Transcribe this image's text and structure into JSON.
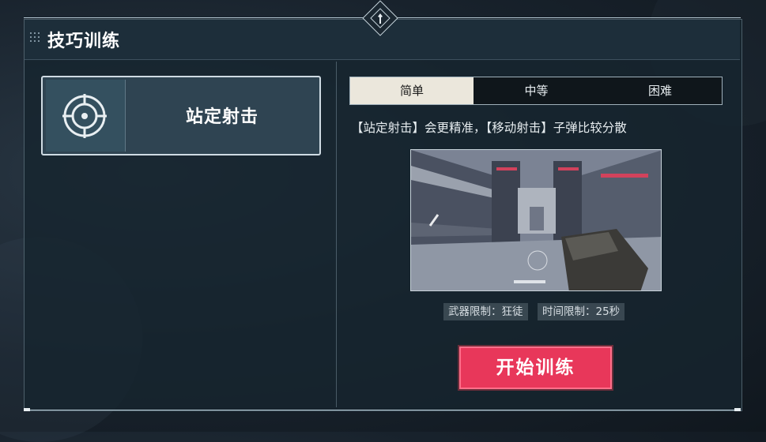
{
  "header": {
    "title": "技巧训练"
  },
  "modes": [
    {
      "label": "站定射击",
      "icon": "crosshair-icon"
    }
  ],
  "difficulty": {
    "tabs": [
      {
        "label": "简单",
        "active": true
      },
      {
        "label": "中等",
        "active": false
      },
      {
        "label": "困难",
        "active": false
      }
    ]
  },
  "description": "【站定射击】会更精准，【移动射击】子弹比较分散",
  "restrictions": {
    "weapon": "武器限制：狂徒",
    "time": "时间限制：25秒"
  },
  "start_button": {
    "label": "开始训练"
  },
  "colors": {
    "accent": "#e8375a",
    "tab_active_bg": "#ebe7dc",
    "panel_bg": "#16242e"
  }
}
